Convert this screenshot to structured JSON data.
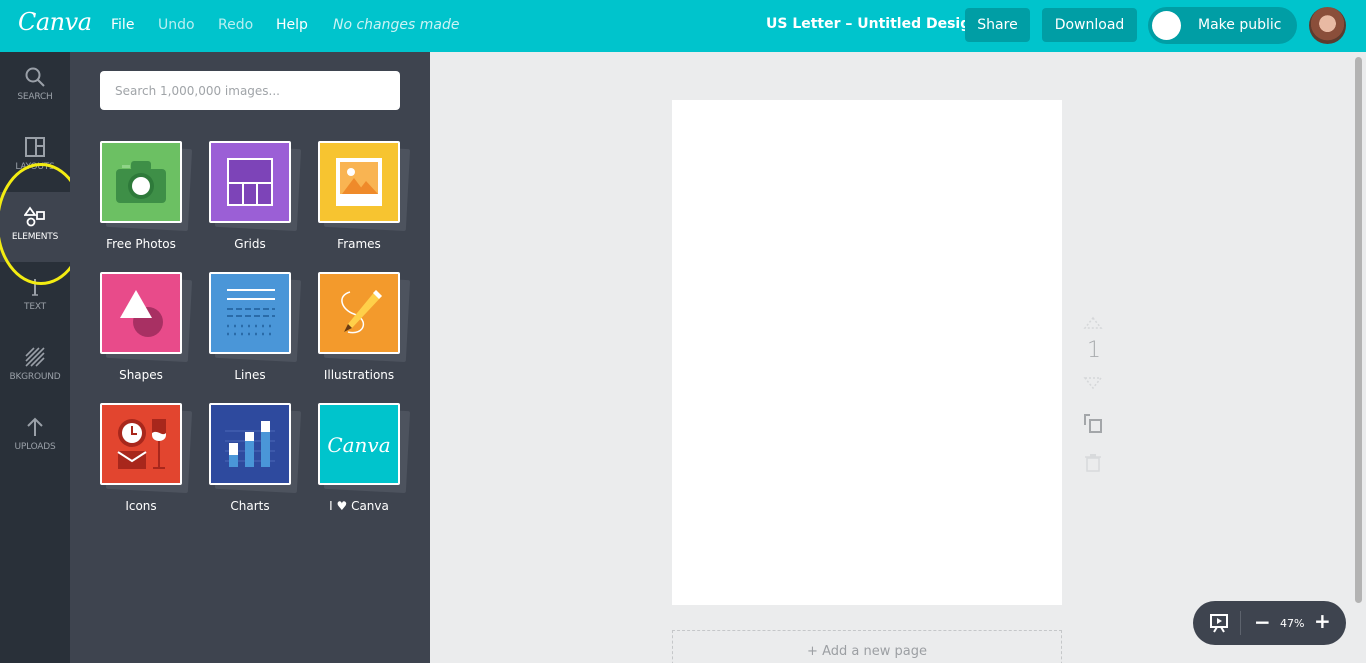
{
  "header": {
    "logo": "Canva",
    "menu": [
      {
        "label": "File"
      },
      {
        "label": "Undo"
      },
      {
        "label": "Redo"
      },
      {
        "label": "Help"
      }
    ],
    "status": "No changes made",
    "doc_title": "US Letter – Untitled Design",
    "share_label": "Share",
    "download_label": "Download",
    "public_toggle": {
      "label": "Make public",
      "on": false
    }
  },
  "rail": {
    "items": [
      {
        "label": "SEARCH",
        "icon": "search-icon"
      },
      {
        "label": "LAYOUTS",
        "icon": "layouts-icon"
      },
      {
        "label": "ELEMENTS",
        "icon": "elements-icon",
        "active": true
      },
      {
        "label": "TEXT",
        "icon": "text-icon"
      },
      {
        "label": "BKGROUND",
        "icon": "background-icon"
      },
      {
        "label": "UPLOADS",
        "icon": "upload-icon"
      }
    ]
  },
  "panel": {
    "search_placeholder": "Search 1,000,000 images...",
    "tiles": [
      {
        "label": "Free Photos",
        "color": "#6cc063"
      },
      {
        "label": "Grids",
        "color": "#9b5fd6"
      },
      {
        "label": "Frames",
        "color": "#f7c430"
      },
      {
        "label": "Shapes",
        "color": "#e84b8a"
      },
      {
        "label": "Lines",
        "color": "#4a96d8"
      },
      {
        "label": "Illustrations",
        "color": "#f39a2c"
      },
      {
        "label": "Icons",
        "color": "#e2452f"
      },
      {
        "label": "Charts",
        "color": "#2e4a9e"
      },
      {
        "label": "I ♥ Canva",
        "color": "#00c4cc"
      }
    ]
  },
  "canvas": {
    "page_number": "1",
    "add_page_label": "+ Add a new page"
  },
  "zoom": {
    "level": "47%",
    "minus": "−",
    "plus": "+"
  },
  "colors": {
    "brand": "#00c4cc",
    "brand_dark": "#009ea5",
    "highlight": "#f3ec12"
  }
}
